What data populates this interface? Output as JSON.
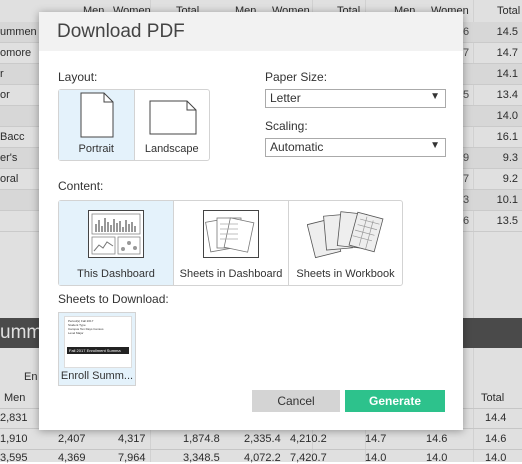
{
  "background": {
    "header_cells": [
      "Men",
      "Women",
      "Total",
      "Men",
      "Women",
      "Total",
      "Men",
      "Women",
      "Total"
    ],
    "rows": [
      {
        "label": "ummen",
        "v1": "6",
        "v2": "14.5"
      },
      {
        "label": "omore",
        "v1": "7",
        "v2": "14.7"
      },
      {
        "label": "r",
        "v1": "",
        "v2": "14.1"
      },
      {
        "label": "or",
        "v1": "5",
        "v2": "13.4"
      },
      {
        "label": "",
        "v1": "",
        "v2": "14.0"
      },
      {
        "label": "Bacc",
        "v1": "",
        "v2": "16.1"
      },
      {
        "label": "er's",
        "v1": "9",
        "v2": "9.3"
      },
      {
        "label": "oral",
        "v1": "7",
        "v2": "9.2"
      },
      {
        "label": "",
        "v1": "3",
        "v2": "10.1"
      },
      {
        "label": "",
        "v1": "6",
        "v2": "13.5"
      }
    ],
    "band_title": "umm",
    "en_label": "En",
    "sub_headers": {
      "men": "Men",
      "total": "Total"
    },
    "lower_rows": [
      [
        "2,831",
        "",
        "",
        "",
        "",
        "",
        "",
        "",
        "14.4"
      ],
      [
        "1,910",
        "2,407",
        "4,317",
        "1,874.8",
        "2,335.4",
        "4,210.2",
        "14.7",
        "14.6",
        "14.6"
      ],
      [
        "3,595",
        "4,369",
        "7,964",
        "3,348.5",
        "4,072.2",
        "7,420.7",
        "14.0",
        "14.0",
        "14.0"
      ]
    ]
  },
  "dialog": {
    "title": "Download PDF",
    "layout": {
      "label": "Layout:",
      "options": [
        "Portrait",
        "Landscape"
      ],
      "selected": "Portrait"
    },
    "paper_size": {
      "label": "Paper Size:",
      "value": "Letter"
    },
    "scaling": {
      "label": "Scaling:",
      "value": "Automatic"
    },
    "content": {
      "label": "Content:",
      "options": [
        "This Dashboard",
        "Sheets in Dashboard",
        "Sheets in Workbook"
      ],
      "selected": "This Dashboard"
    },
    "sheets": {
      "label": "Sheets to Download:",
      "items": [
        {
          "label": "Enroll Summ...",
          "preview_banner": "Fall 2017 Enrollment Summa",
          "preview_lines": [
            "Period(s)",
            "Fall 2017",
            "Student",
            "Type",
            "Campus",
            "Ten Days Census",
            "Level",
            "Major"
          ]
        }
      ]
    },
    "buttons": {
      "cancel": "Cancel",
      "generate": "Generate"
    },
    "colors": {
      "accent": "#2dc28c",
      "selected_bg": "#e4f2fb"
    }
  }
}
